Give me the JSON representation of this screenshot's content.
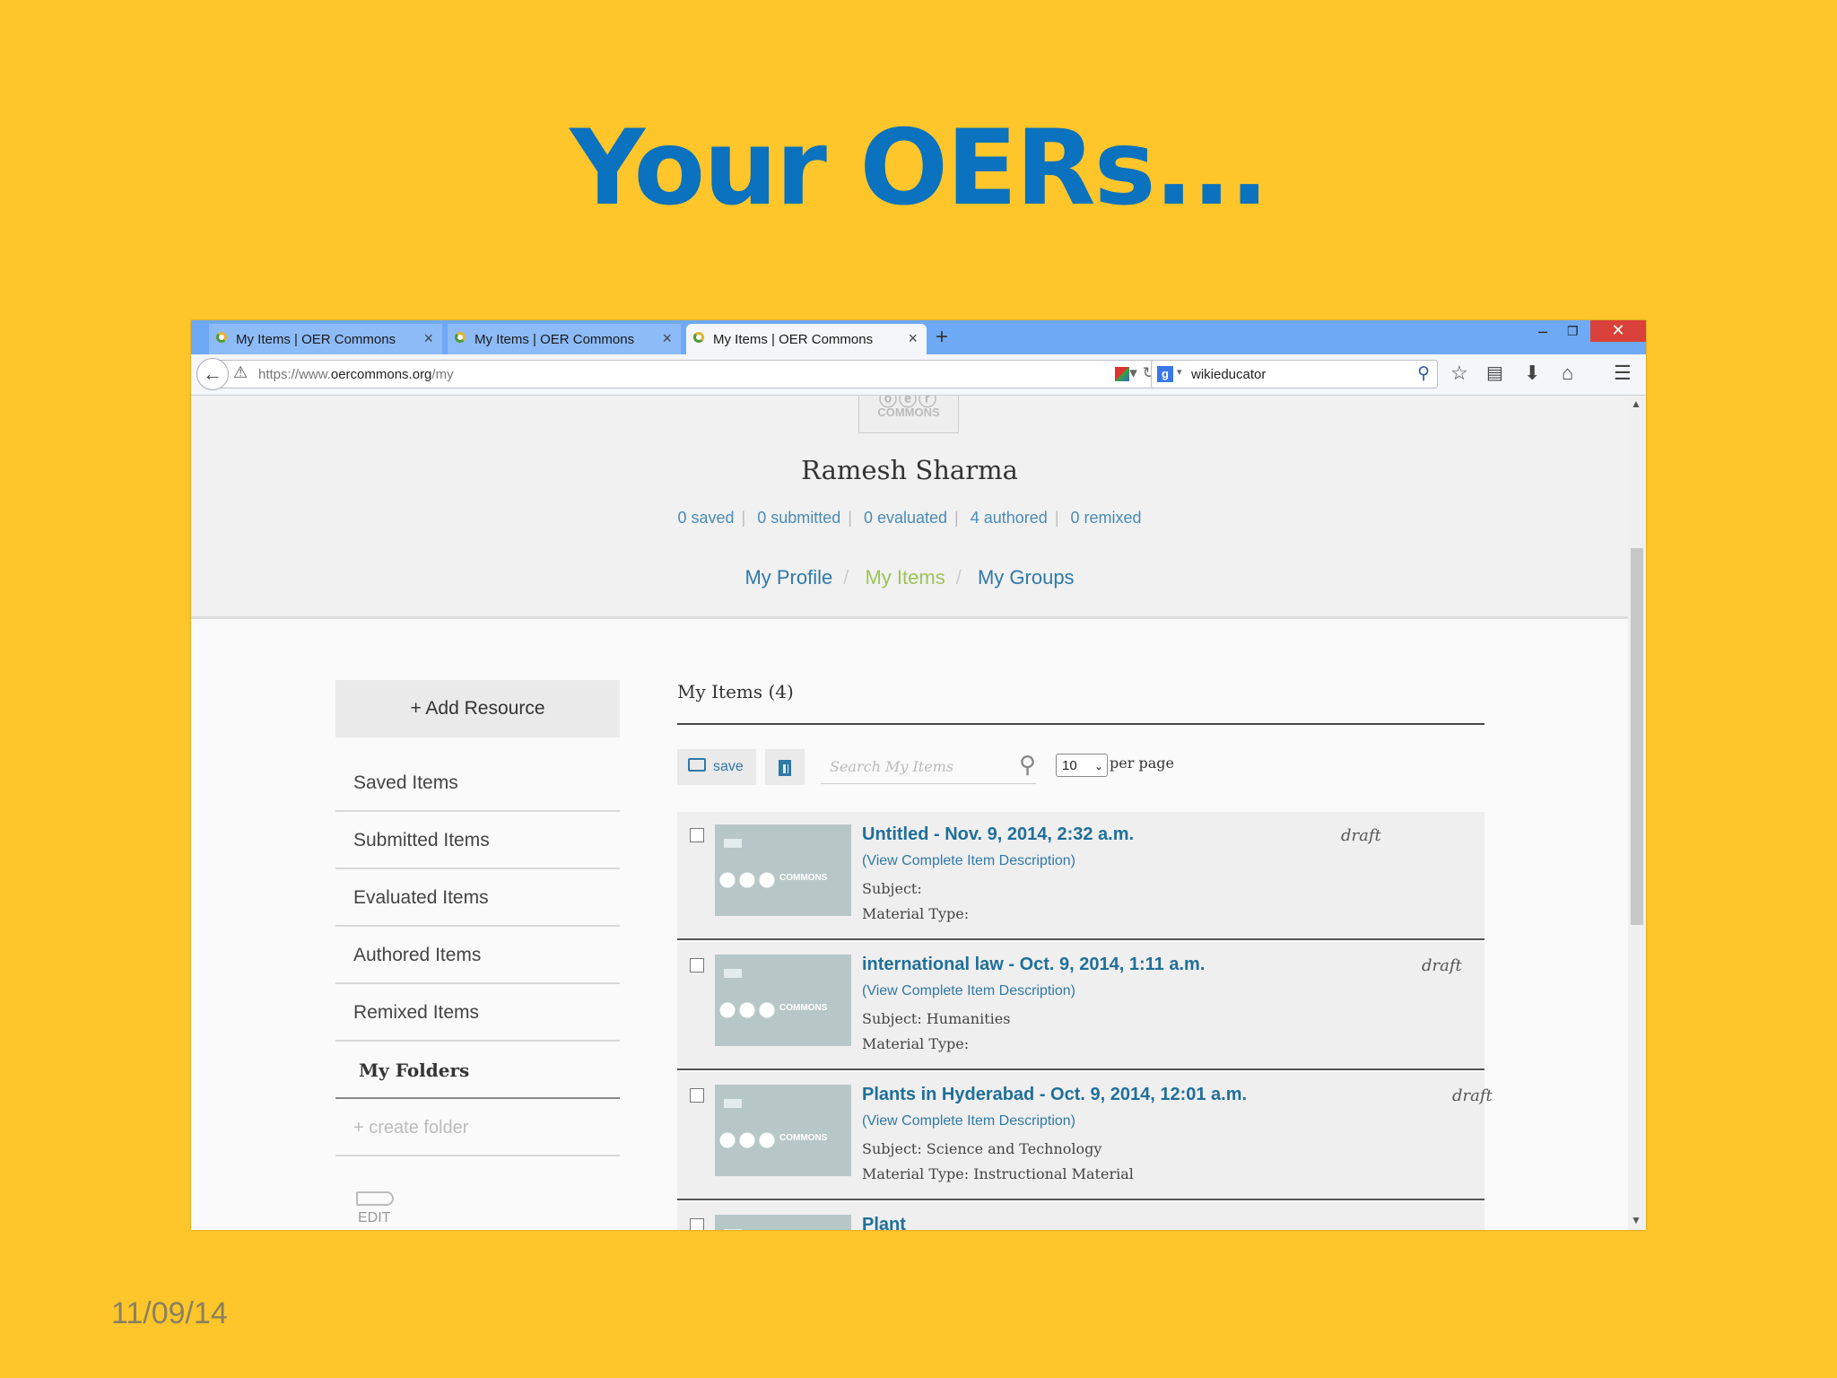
{
  "slide": {
    "title": "Your OERs...",
    "date": "11/09/14"
  },
  "browser": {
    "tabs": [
      {
        "label": "My Items | OER Commons",
        "close": "×"
      },
      {
        "label": "My Items | OER Commons",
        "close": "×"
      },
      {
        "label": "My Items | OER Commons",
        "close": "×"
      }
    ],
    "new_tab": "+",
    "window_controls": {
      "minimize": "–",
      "restore": "❐",
      "close": "✕"
    },
    "url_prefix": "https://www.",
    "url_domain": "oercommons.org",
    "url_path": "/my",
    "search_engine_icon": "g",
    "search_text": "wikieducator",
    "icons": [
      "back-icon",
      "warning-icon",
      "reload-icon",
      "search-go-icon",
      "bookmark-star-icon",
      "reading-list-icon",
      "download-icon",
      "home-icon",
      "menu-icon"
    ]
  },
  "profile": {
    "logo_text": "COMMONS",
    "name": "Ramesh Sharma",
    "stats": [
      "0 saved",
      "0 submitted",
      "0 evaluated",
      "4 authored",
      "0 remixed"
    ],
    "nav": {
      "profile": "My Profile",
      "items": "My Items",
      "groups": "My Groups"
    },
    "nav_separator": "/"
  },
  "sidebar": {
    "add_resource": "+ Add Resource",
    "items": [
      "Saved Items",
      "Submitted Items",
      "Evaluated Items",
      "Authored Items",
      "Remixed Items"
    ],
    "folders_heading": "My Folders",
    "create_folder": "+ create folder",
    "edit_label": "EDIT"
  },
  "main": {
    "title": "My Items (4)",
    "save_label": "save",
    "search_placeholder": "Search My Items",
    "per_page_value": "10",
    "per_page_label": "per page",
    "desc_link": "(View Complete Item Description)",
    "items": [
      {
        "title": "Untitled - Nov. 9, 2014, 2:32 a.m.",
        "status": "draft",
        "subject": "Subject:",
        "type": "Material Type:"
      },
      {
        "title": "international law - Oct. 9, 2014, 1:11 a.m.",
        "status": "draft",
        "subject": "Subject: Humanities",
        "type": "Material Type:"
      },
      {
        "title": "Plants in Hyderabad - Oct. 9, 2014, 12:01 a.m.",
        "status": "draft",
        "subject": "Subject: Science and Technology",
        "type": "Material Type: Instructional Material"
      },
      {
        "title": "Plant",
        "status": "",
        "subject": "",
        "type": ""
      }
    ]
  },
  "colors": {
    "background": "#FEC62A",
    "title": "#0A72BE",
    "link": "#2F79A8",
    "nav_current": "#9CC45A",
    "tabbar": "#6EA9F5"
  }
}
